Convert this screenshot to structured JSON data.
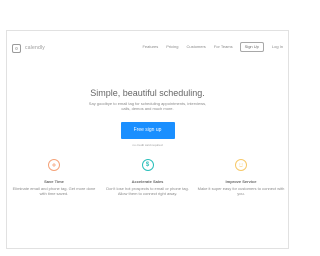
{
  "brand": {
    "name": "calendly",
    "accent": "#1a8fff"
  },
  "nav": {
    "links": [
      "Features",
      "Pricing",
      "Customers",
      "For Teams"
    ],
    "signup": "Sign Up",
    "login": "Log In"
  },
  "hero": {
    "title": "Simple, beautiful scheduling.",
    "subtitle": "Say goodbye to email tag for scheduling appointments, interviews, calls, demos and much more.",
    "cta": "Free sign up",
    "cta_note": "no credit card required"
  },
  "features": [
    {
      "icon": "plus-circle-icon",
      "icon_color": "#f5a37a",
      "title": "Save Time",
      "desc": "Eliminate email and phone tag. Get more done with time saved."
    },
    {
      "icon": "dollar-circle-icon",
      "icon_color": "#2bbfbb",
      "title": "Accelerate Sales",
      "desc": "Don't lose hot prospects to email or phone tag. Allow them to connect right away."
    },
    {
      "icon": "smiley-circle-icon",
      "icon_color": "#f7c96a",
      "title": "Improve Service",
      "desc": "Make it super easy for customers to connect with you."
    }
  ]
}
